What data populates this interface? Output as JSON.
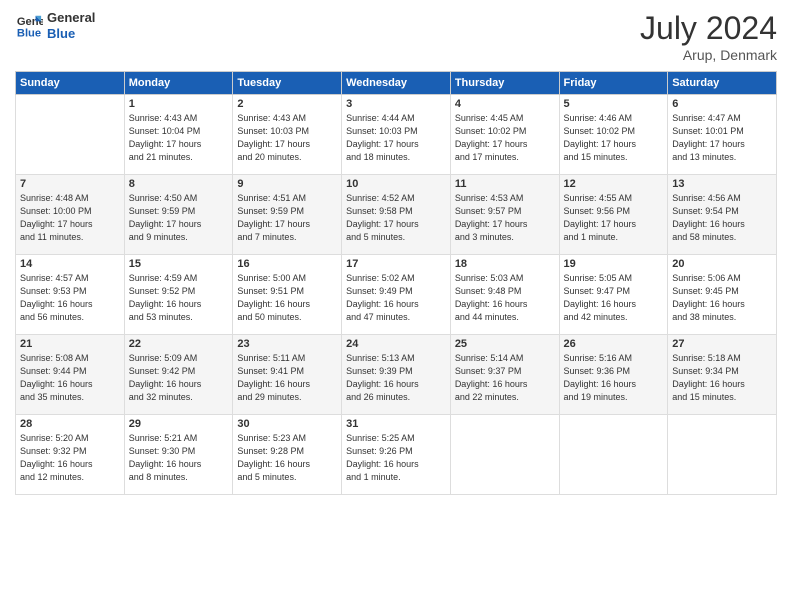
{
  "header": {
    "logo_line1": "General",
    "logo_line2": "Blue",
    "title": "July 2024",
    "location": "Arup, Denmark"
  },
  "days_of_week": [
    "Sunday",
    "Monday",
    "Tuesday",
    "Wednesday",
    "Thursday",
    "Friday",
    "Saturday"
  ],
  "weeks": [
    [
      {
        "num": "",
        "lines": []
      },
      {
        "num": "1",
        "lines": [
          "Sunrise: 4:43 AM",
          "Sunset: 10:04 PM",
          "Daylight: 17 hours",
          "and 21 minutes."
        ]
      },
      {
        "num": "2",
        "lines": [
          "Sunrise: 4:43 AM",
          "Sunset: 10:03 PM",
          "Daylight: 17 hours",
          "and 20 minutes."
        ]
      },
      {
        "num": "3",
        "lines": [
          "Sunrise: 4:44 AM",
          "Sunset: 10:03 PM",
          "Daylight: 17 hours",
          "and 18 minutes."
        ]
      },
      {
        "num": "4",
        "lines": [
          "Sunrise: 4:45 AM",
          "Sunset: 10:02 PM",
          "Daylight: 17 hours",
          "and 17 minutes."
        ]
      },
      {
        "num": "5",
        "lines": [
          "Sunrise: 4:46 AM",
          "Sunset: 10:02 PM",
          "Daylight: 17 hours",
          "and 15 minutes."
        ]
      },
      {
        "num": "6",
        "lines": [
          "Sunrise: 4:47 AM",
          "Sunset: 10:01 PM",
          "Daylight: 17 hours",
          "and 13 minutes."
        ]
      }
    ],
    [
      {
        "num": "7",
        "lines": [
          "Sunrise: 4:48 AM",
          "Sunset: 10:00 PM",
          "Daylight: 17 hours",
          "and 11 minutes."
        ]
      },
      {
        "num": "8",
        "lines": [
          "Sunrise: 4:50 AM",
          "Sunset: 9:59 PM",
          "Daylight: 17 hours",
          "and 9 minutes."
        ]
      },
      {
        "num": "9",
        "lines": [
          "Sunrise: 4:51 AM",
          "Sunset: 9:59 PM",
          "Daylight: 17 hours",
          "and 7 minutes."
        ]
      },
      {
        "num": "10",
        "lines": [
          "Sunrise: 4:52 AM",
          "Sunset: 9:58 PM",
          "Daylight: 17 hours",
          "and 5 minutes."
        ]
      },
      {
        "num": "11",
        "lines": [
          "Sunrise: 4:53 AM",
          "Sunset: 9:57 PM",
          "Daylight: 17 hours",
          "and 3 minutes."
        ]
      },
      {
        "num": "12",
        "lines": [
          "Sunrise: 4:55 AM",
          "Sunset: 9:56 PM",
          "Daylight: 17 hours",
          "and 1 minute."
        ]
      },
      {
        "num": "13",
        "lines": [
          "Sunrise: 4:56 AM",
          "Sunset: 9:54 PM",
          "Daylight: 16 hours",
          "and 58 minutes."
        ]
      }
    ],
    [
      {
        "num": "14",
        "lines": [
          "Sunrise: 4:57 AM",
          "Sunset: 9:53 PM",
          "Daylight: 16 hours",
          "and 56 minutes."
        ]
      },
      {
        "num": "15",
        "lines": [
          "Sunrise: 4:59 AM",
          "Sunset: 9:52 PM",
          "Daylight: 16 hours",
          "and 53 minutes."
        ]
      },
      {
        "num": "16",
        "lines": [
          "Sunrise: 5:00 AM",
          "Sunset: 9:51 PM",
          "Daylight: 16 hours",
          "and 50 minutes."
        ]
      },
      {
        "num": "17",
        "lines": [
          "Sunrise: 5:02 AM",
          "Sunset: 9:49 PM",
          "Daylight: 16 hours",
          "and 47 minutes."
        ]
      },
      {
        "num": "18",
        "lines": [
          "Sunrise: 5:03 AM",
          "Sunset: 9:48 PM",
          "Daylight: 16 hours",
          "and 44 minutes."
        ]
      },
      {
        "num": "19",
        "lines": [
          "Sunrise: 5:05 AM",
          "Sunset: 9:47 PM",
          "Daylight: 16 hours",
          "and 42 minutes."
        ]
      },
      {
        "num": "20",
        "lines": [
          "Sunrise: 5:06 AM",
          "Sunset: 9:45 PM",
          "Daylight: 16 hours",
          "and 38 minutes."
        ]
      }
    ],
    [
      {
        "num": "21",
        "lines": [
          "Sunrise: 5:08 AM",
          "Sunset: 9:44 PM",
          "Daylight: 16 hours",
          "and 35 minutes."
        ]
      },
      {
        "num": "22",
        "lines": [
          "Sunrise: 5:09 AM",
          "Sunset: 9:42 PM",
          "Daylight: 16 hours",
          "and 32 minutes."
        ]
      },
      {
        "num": "23",
        "lines": [
          "Sunrise: 5:11 AM",
          "Sunset: 9:41 PM",
          "Daylight: 16 hours",
          "and 29 minutes."
        ]
      },
      {
        "num": "24",
        "lines": [
          "Sunrise: 5:13 AM",
          "Sunset: 9:39 PM",
          "Daylight: 16 hours",
          "and 26 minutes."
        ]
      },
      {
        "num": "25",
        "lines": [
          "Sunrise: 5:14 AM",
          "Sunset: 9:37 PM",
          "Daylight: 16 hours",
          "and 22 minutes."
        ]
      },
      {
        "num": "26",
        "lines": [
          "Sunrise: 5:16 AM",
          "Sunset: 9:36 PM",
          "Daylight: 16 hours",
          "and 19 minutes."
        ]
      },
      {
        "num": "27",
        "lines": [
          "Sunrise: 5:18 AM",
          "Sunset: 9:34 PM",
          "Daylight: 16 hours",
          "and 15 minutes."
        ]
      }
    ],
    [
      {
        "num": "28",
        "lines": [
          "Sunrise: 5:20 AM",
          "Sunset: 9:32 PM",
          "Daylight: 16 hours",
          "and 12 minutes."
        ]
      },
      {
        "num": "29",
        "lines": [
          "Sunrise: 5:21 AM",
          "Sunset: 9:30 PM",
          "Daylight: 16 hours",
          "and 8 minutes."
        ]
      },
      {
        "num": "30",
        "lines": [
          "Sunrise: 5:23 AM",
          "Sunset: 9:28 PM",
          "Daylight: 16 hours",
          "and 5 minutes."
        ]
      },
      {
        "num": "31",
        "lines": [
          "Sunrise: 5:25 AM",
          "Sunset: 9:26 PM",
          "Daylight: 16 hours",
          "and 1 minute."
        ]
      },
      {
        "num": "",
        "lines": []
      },
      {
        "num": "",
        "lines": []
      },
      {
        "num": "",
        "lines": []
      }
    ]
  ]
}
